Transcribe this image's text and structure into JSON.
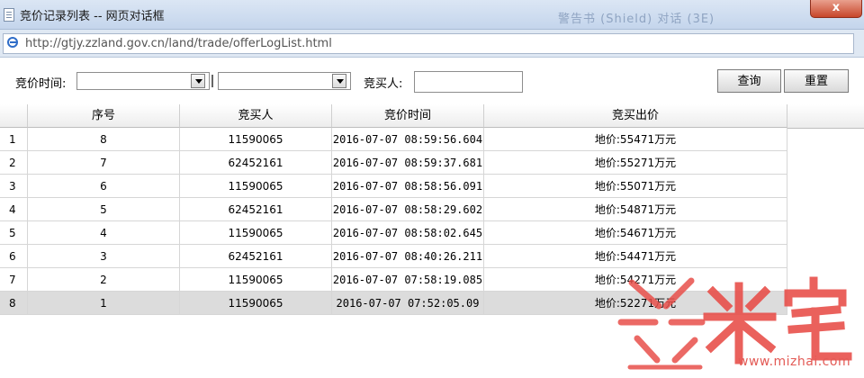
{
  "window": {
    "title": "竞价记录列表 -- 网页对话框",
    "close_label": "x",
    "background_faint_text": "警告书 (Shield) 对话 (3E)"
  },
  "address_bar": {
    "url": "http://gtjy.zzland.gov.cn/land/trade/offerLogList.html"
  },
  "filter": {
    "time_label": "竞价时间:",
    "time_from_value": "",
    "time_to_value": "",
    "bidder_label": "竞买人:",
    "bidder_value": "",
    "query_label": "查询",
    "reset_label": "重置"
  },
  "table": {
    "headers": [
      "序号",
      "竞买人",
      "竞价时间",
      "竞买出价"
    ],
    "rows": [
      {
        "idx": "1",
        "seq": "8",
        "bidder": "11590065",
        "time": "2016-07-07 08:59:56.604",
        "price": "地价:55471万元"
      },
      {
        "idx": "2",
        "seq": "7",
        "bidder": "62452161",
        "time": "2016-07-07 08:59:37.681",
        "price": "地价:55271万元"
      },
      {
        "idx": "3",
        "seq": "6",
        "bidder": "11590065",
        "time": "2016-07-07 08:58:56.091",
        "price": "地价:55071万元"
      },
      {
        "idx": "4",
        "seq": "5",
        "bidder": "62452161",
        "time": "2016-07-07 08:58:29.602",
        "price": "地价:54871万元"
      },
      {
        "idx": "5",
        "seq": "4",
        "bidder": "11590065",
        "time": "2016-07-07 08:58:02.645",
        "price": "地价:54671万元"
      },
      {
        "idx": "6",
        "seq": "3",
        "bidder": "62452161",
        "time": "2016-07-07 08:40:26.211",
        "price": "地价:54471万元"
      },
      {
        "idx": "7",
        "seq": "2",
        "bidder": "11590065",
        "time": "2016-07-07 07:58:19.085",
        "price": "地价:54271万元"
      },
      {
        "idx": "8",
        "seq": "1",
        "bidder": "11590065",
        "time": "2016-07-07 07:52:05.09",
        "price": "地价:52271万元"
      }
    ]
  },
  "watermark": {
    "brand": "米宅",
    "url": "www.mizhai.com",
    "color": "#e8504b"
  }
}
